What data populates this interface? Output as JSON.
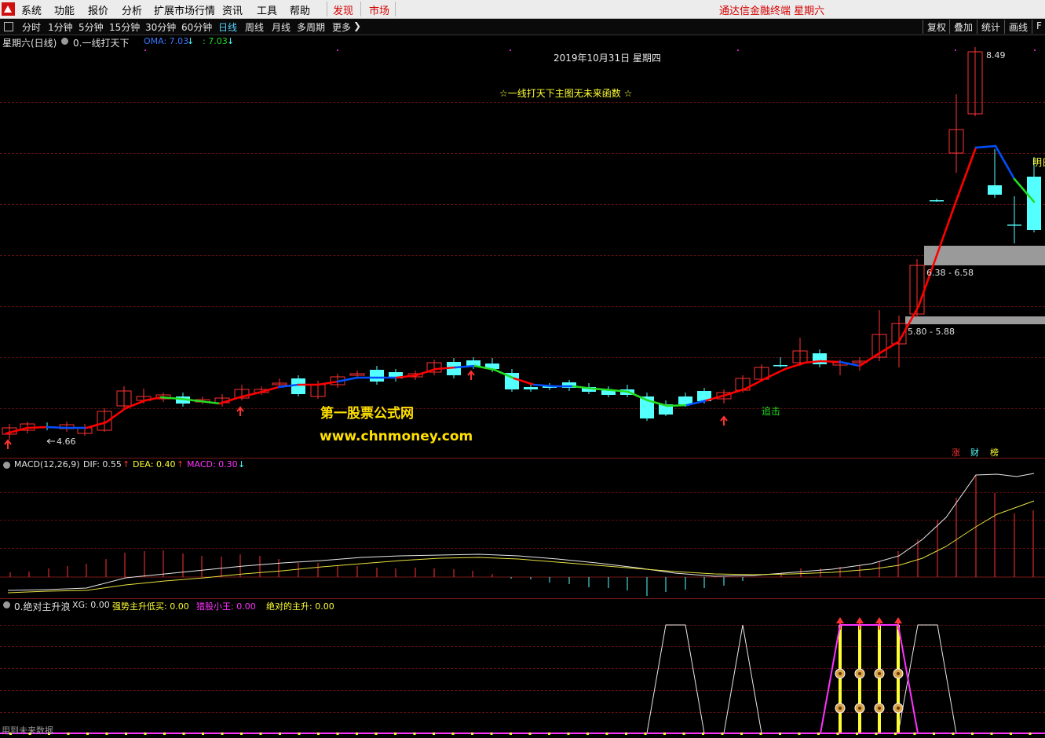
{
  "menubar": {
    "items": [
      "系统",
      "功能",
      "报价",
      "分析",
      "扩展市场行情",
      "资讯",
      "工具",
      "帮助"
    ],
    "highlight_items": [
      "发现",
      "市场"
    ],
    "title": "通达信金融终端  星期六"
  },
  "toolbar": {
    "periods": [
      "分时",
      "1分钟",
      "5分钟",
      "15分钟",
      "30分钟",
      "60分钟",
      "日线",
      "周线",
      "月线",
      "多周期",
      "更多"
    ],
    "active_period": "日线",
    "right_buttons": [
      "复权",
      "叠加",
      "统计",
      "画线",
      "F"
    ]
  },
  "main_panel": {
    "stock_label": "星期六(日线)",
    "indicator_name": "0.一线打天下",
    "oma_label": "OMA: 7.03",
    "oma2_label": ": 7.03",
    "date_text": "2019年10月31日  星期四",
    "formula_note": "☆一线打天下主图无未来函数 ☆",
    "high_price": "8.49",
    "low_price": "4.66",
    "zone_upper": "6.38 - 6.58",
    "zone_lower": "5.80 - 5.88",
    "chase_label": "追击",
    "tomorrow_label": "明日",
    "corner_tags": [
      "涨",
      "财",
      "榜"
    ]
  },
  "watermark": {
    "line1": "第一股票公式网",
    "line2": "www.chnmoney.com"
  },
  "macd_panel": {
    "label": "MACD(12,26,9)",
    "dif": "DIF: 0.55",
    "dea": "DEA: 0.40",
    "macd": "MACD: 0.30"
  },
  "signal_panel": {
    "label": "0.绝对主升浪",
    "xg": "XG: 0.00",
    "s1": "强势主升低买: 0.00",
    "s2": "猎股小王: 0.00",
    "s3": "绝对的主升: 0.00",
    "footer": "用到未来数据"
  },
  "colors": {
    "up": "#ff3232",
    "down": "#54ffff",
    "ma_red": "#ff0000",
    "ma_blue": "#0050ff",
    "ma_green": "#22dd22",
    "yellow": "#ffff33",
    "magenta": "#ff33ff"
  }
}
